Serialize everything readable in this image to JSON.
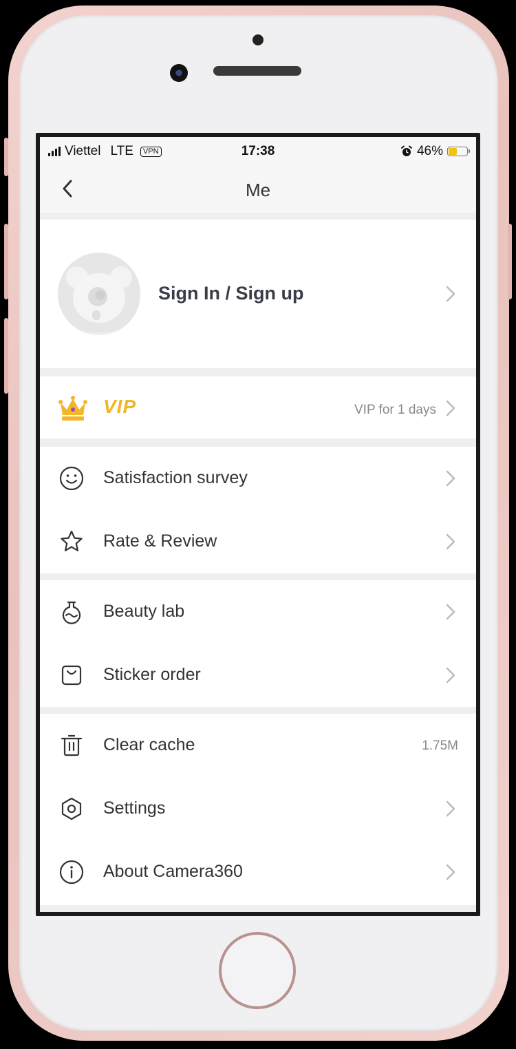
{
  "status_bar": {
    "carrier": "Viettel",
    "network": "LTE",
    "vpn": "VPN",
    "time": "17:38",
    "battery_percent": "46%",
    "battery_level": 0.46,
    "alarm_icon": "alarm-icon"
  },
  "nav": {
    "title": "Me",
    "back_icon": "chevron-left-icon"
  },
  "profile": {
    "label": "Sign In / Sign up",
    "avatar_icon": "panda-avatar-icon"
  },
  "vip": {
    "label": "VIP",
    "value": "VIP for 1 days",
    "icon": "crown-icon",
    "color": "#f0b62a"
  },
  "menu": {
    "survey": {
      "label": "Satisfaction survey",
      "icon": "smiley-icon"
    },
    "rate": {
      "label": "Rate & Review",
      "icon": "star-icon"
    },
    "beauty": {
      "label": "Beauty lab",
      "icon": "flask-icon"
    },
    "sticker": {
      "label": "Sticker order",
      "icon": "bag-icon"
    },
    "cache": {
      "label": "Clear cache",
      "value": "1.75M",
      "icon": "trash-icon"
    },
    "settings": {
      "label": "Settings",
      "icon": "hexagon-gear-icon"
    },
    "about": {
      "label": "About Camera360",
      "icon": "info-icon"
    }
  }
}
